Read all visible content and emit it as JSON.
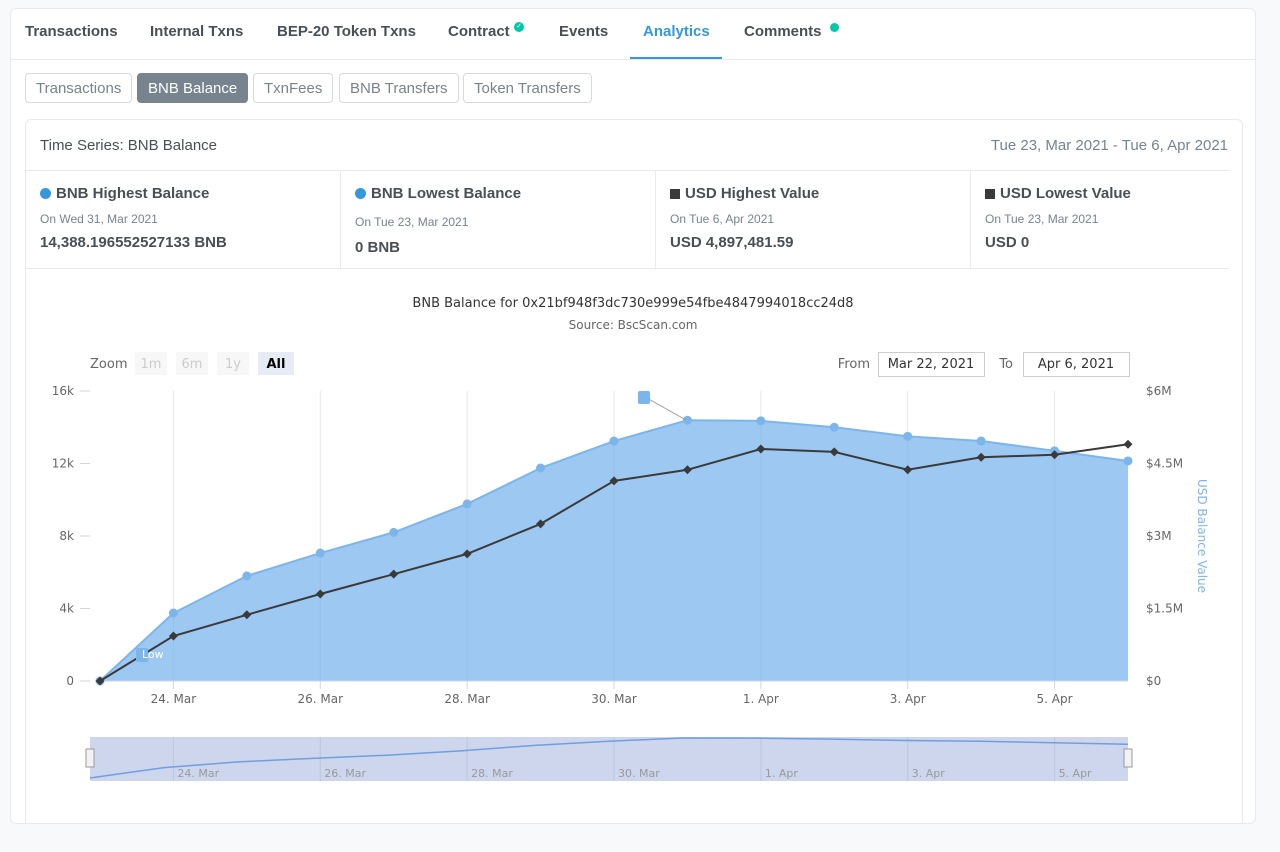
{
  "tabs": [
    {
      "label": "Transactions"
    },
    {
      "label": "Internal Txns"
    },
    {
      "label": "BEP-20 Token Txns"
    },
    {
      "label": "Contract",
      "badge": "verified-check-icon"
    },
    {
      "label": "Events"
    },
    {
      "label": "Analytics",
      "active": true
    },
    {
      "label": "Comments",
      "badge": "dot"
    }
  ],
  "subtabs": [
    {
      "label": "Transactions"
    },
    {
      "label": "BNB Balance",
      "active": true
    },
    {
      "label": "TxnFees"
    },
    {
      "label": "BNB Transfers"
    },
    {
      "label": "Token Transfers"
    }
  ],
  "card": {
    "title": "Time Series: BNB Balance",
    "range": "Tue 23, Mar 2021 - Tue 6, Apr 2021"
  },
  "stats": [
    {
      "label": "BNB Highest Balance",
      "date": "On Wed 31, Mar 2021",
      "value": "14,388.196552527133 BNB",
      "marker": "circle",
      "color": "#3498db"
    },
    {
      "label": "BNB Lowest Balance",
      "date": "On Tue 23, Mar 2021",
      "value": "0 BNB",
      "marker": "circle",
      "color": "#3498db"
    },
    {
      "label": "USD Highest Value",
      "date": "On Tue 6, Apr 2021",
      "value": "USD 4,897,481.59",
      "marker": "square",
      "color": "#3a3a3a"
    },
    {
      "label": "USD Lowest Value",
      "date": "On Tue 23, Mar 2021",
      "value": "USD 0",
      "marker": "square",
      "color": "#3a3a3a"
    }
  ],
  "chart_data": {
    "type": "area",
    "title": "BNB Balance for 0x21bf948f3dc730e999e54fbe4847994018cc24d8",
    "subtitle": "Source: BscScan.com",
    "zoom_label": "Zoom",
    "zoom_buttons": [
      "1m",
      "6m",
      "1y",
      "All"
    ],
    "zoom_selected": "All",
    "from_label": "From",
    "from_value": "Mar 22, 2021",
    "to_label": "To",
    "to_value": "Apr 6, 2021",
    "x": [
      "2021-03-23",
      "2021-03-24",
      "2021-03-25",
      "2021-03-26",
      "2021-03-27",
      "2021-03-28",
      "2021-03-29",
      "2021-03-30",
      "2021-03-31",
      "2021-04-01",
      "2021-04-02",
      "2021-04-03",
      "2021-04-04",
      "2021-04-05",
      "2021-04-06"
    ],
    "x_tick_labels": [
      "24. Mar",
      "26. Mar",
      "28. Mar",
      "30. Mar",
      "1. Apr",
      "3. Apr",
      "5. Apr"
    ],
    "y_left": {
      "ticks": [
        "0",
        "4k",
        "8k",
        "12k",
        "16k"
      ],
      "range": [
        0,
        16000
      ]
    },
    "y_right": {
      "label": "USD Balance Value",
      "ticks": [
        "$0",
        "$1.5M",
        "$3M",
        "$4.5M",
        "$6M"
      ],
      "range": [
        0,
        6000000
      ]
    },
    "series": [
      {
        "type": "area",
        "axis": "left",
        "color": "#7cb5ec",
        "values": [
          0,
          3750,
          5800,
          7060,
          8200,
          9770,
          11750,
          13240,
          14388,
          14350,
          14000,
          13500,
          13240,
          12700,
          12140
        ]
      },
      {
        "type": "line",
        "axis": "right",
        "color": "#3a3a3a",
        "values": [
          0,
          930000,
          1370000,
          1800000,
          2210000,
          2630000,
          3250000,
          4140000,
          4370000,
          4800000,
          4740000,
          4370000,
          4630000,
          4680000,
          4897481.59
        ]
      }
    ],
    "flags": [
      {
        "text": "Low"
      }
    ],
    "grid": "vertical"
  }
}
